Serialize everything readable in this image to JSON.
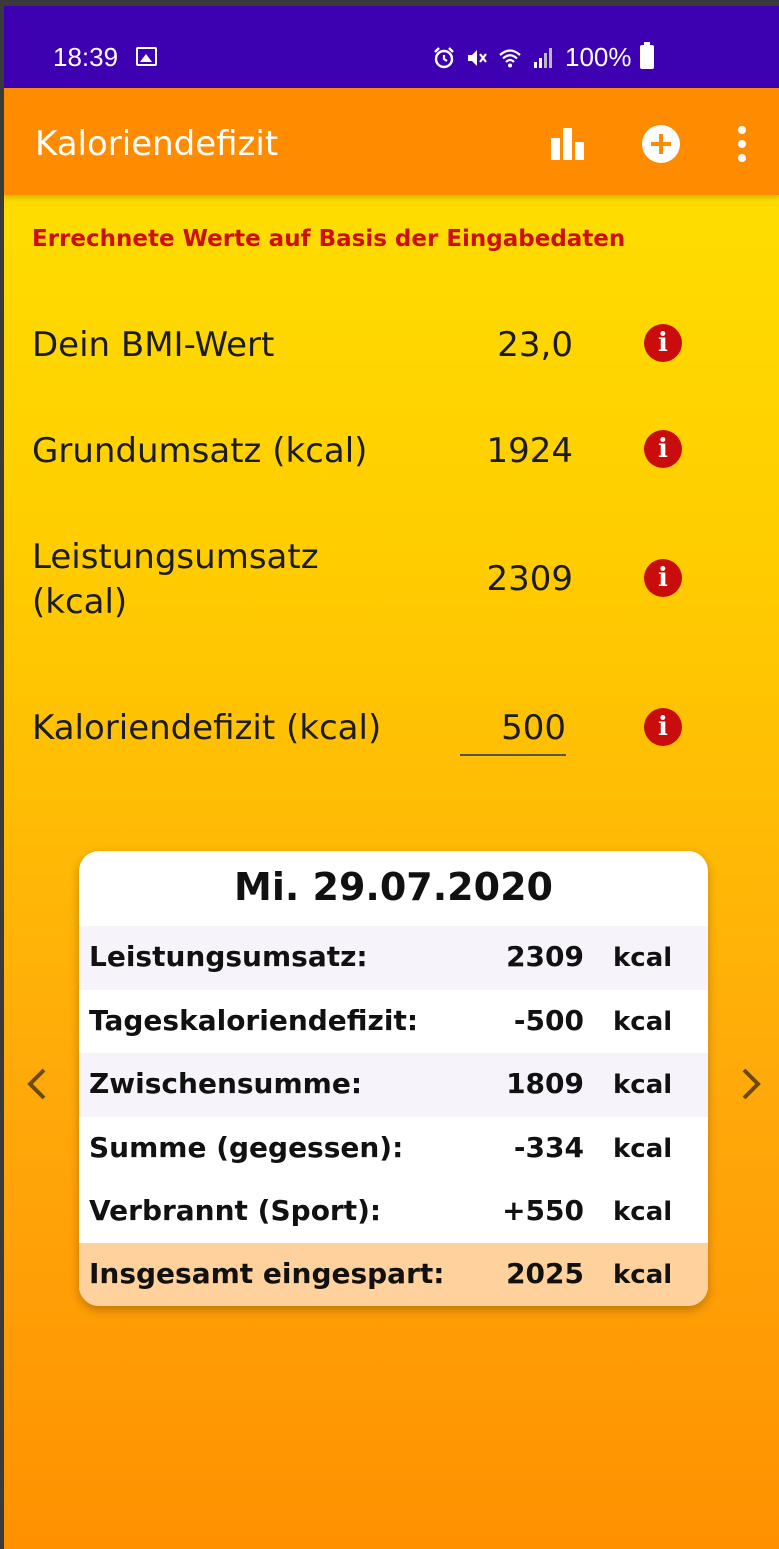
{
  "status_bar": {
    "time": "18:39",
    "battery": "100%",
    "icons": [
      "gallery-icon",
      "alarm-icon",
      "mute-icon",
      "wifi-icon",
      "signal-icon",
      "battery-icon"
    ]
  },
  "app_bar": {
    "title": "Kaloriendefizit",
    "actions": [
      "bar-chart-icon",
      "add-circle-icon",
      "more-vert-icon"
    ]
  },
  "section_title": "Errechnete Werte auf Basis der Eingabedaten",
  "values": {
    "bmi": {
      "label": "Dein BMI-Wert",
      "value": "23,0"
    },
    "grundumsatz": {
      "label": "Grundumsatz (kcal)",
      "value": "1924"
    },
    "leistungsumsatz": {
      "label_line1": "Leistungsumsatz",
      "label_line2": "(kcal)",
      "value": "2309"
    },
    "kaloriendefizit": {
      "label": "Kaloriendefizit (kcal)",
      "value": "500"
    }
  },
  "info_symbol": "i",
  "card": {
    "date": "Mi. 29.07.2020",
    "rows": [
      {
        "label": "Leistungsumsatz:",
        "value": "2309",
        "unit": "kcal"
      },
      {
        "label": "Tageskaloriendefizit:",
        "value": "-500",
        "unit": "kcal"
      },
      {
        "label": "Zwischensumme:",
        "value": "1809",
        "unit": "kcal"
      },
      {
        "label": "Summe (gegessen):",
        "value": "-334",
        "unit": "kcal"
      },
      {
        "label": "Verbrannt (Sport):",
        "value": "+550",
        "unit": "kcal"
      },
      {
        "label": "Insgesamt eingespart:",
        "value": "2025",
        "unit": "kcal"
      }
    ]
  },
  "colors": {
    "status_bar": "#3d01b1",
    "app_bar": "#ff8c00",
    "accent_red": "#c90d0d",
    "total_row": "#ffd19c"
  }
}
